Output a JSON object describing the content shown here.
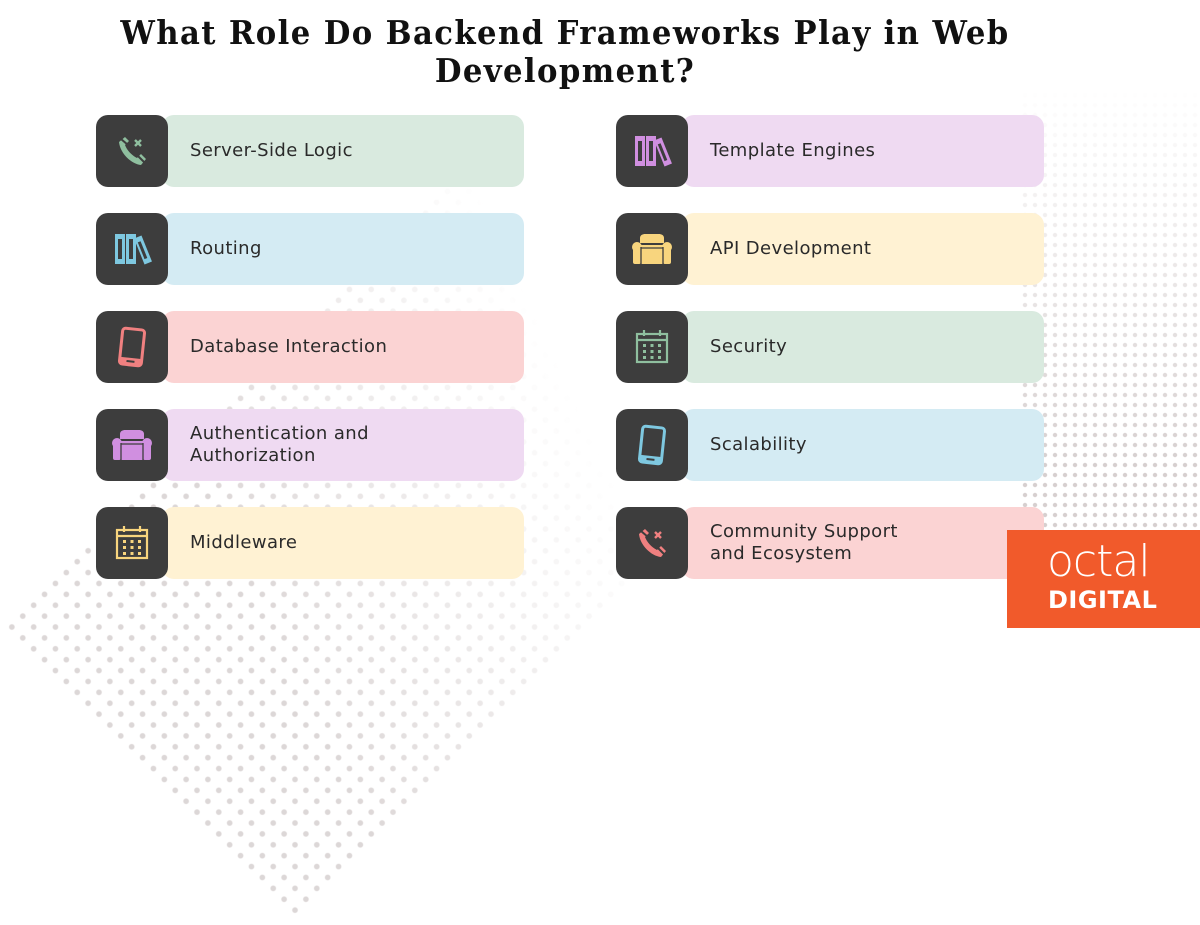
{
  "title": {
    "line1": "What Role Do Backend Frameworks Play in Web",
    "line2": "Development?"
  },
  "colors": {
    "icon_bg": "#3d3d3d",
    "green": {
      "card": "#d9eadf",
      "icon": "#8fbf9f"
    },
    "blue": {
      "card": "#d4ebf3",
      "icon": "#7ec8e0"
    },
    "pink": {
      "card": "#fbd3d3",
      "icon": "#f08080"
    },
    "purple": {
      "card": "#efdaf2",
      "icon": "#d08fe0"
    },
    "yellow": {
      "card": "#fff2d3",
      "icon": "#f8d57e"
    },
    "brand": "#f15a2b"
  },
  "items": [
    {
      "label": "Server-Side Logic",
      "icon": "phone-handset-icon",
      "theme": "green"
    },
    {
      "label": "Routing",
      "icon": "books-icon",
      "theme": "blue"
    },
    {
      "label": "Database Interaction",
      "icon": "smartphone-icon",
      "theme": "pink"
    },
    {
      "label": "Authentication and Authorization",
      "icon": "armchair-icon",
      "theme": "purple"
    },
    {
      "label": "Middleware",
      "icon": "calendar-icon",
      "theme": "yellow"
    },
    {
      "label": "Template Engines",
      "icon": "books-icon",
      "theme": "purple"
    },
    {
      "label": "API Development",
      "icon": "armchair-icon",
      "theme": "yellow"
    },
    {
      "label": "Security",
      "icon": "calendar-icon",
      "theme": "green"
    },
    {
      "label": "Scalability",
      "icon": "smartphone-icon",
      "theme": "blue"
    },
    {
      "label": "Community Support and Ecosystem",
      "icon": "phone-handset-icon",
      "theme": "pink"
    }
  ],
  "logo": {
    "line1": "octal",
    "line2": "DIGITAL"
  }
}
